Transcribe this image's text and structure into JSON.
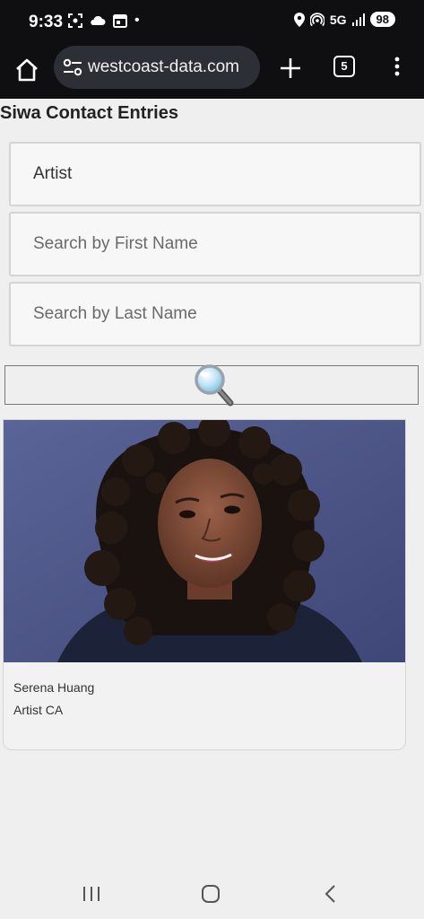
{
  "status_bar": {
    "time": "9:33",
    "dot": "•",
    "network": "5G",
    "battery": "98",
    "icons": [
      "screenshot-icon",
      "cloud-icon",
      "calendar-icon",
      "location-icon",
      "hotspot-icon",
      "signal-icon"
    ]
  },
  "browser": {
    "url": "westcoast-data.com",
    "tab_count": "5"
  },
  "page": {
    "title": "Siwa Contact Entries"
  },
  "form": {
    "profession_value": "Artist",
    "first_name_placeholder": "Search by First Name",
    "last_name_placeholder": "Search by Last Name"
  },
  "results": [
    {
      "name": "Serena Huang",
      "subtitle": "Artist CA"
    }
  ],
  "colors": {
    "browser_chrome": "#0f0f12",
    "url_pill": "#2d2f36",
    "page_bg": "#efefef",
    "photo_bg": "#4a548a",
    "sweater": "#1c2338"
  }
}
